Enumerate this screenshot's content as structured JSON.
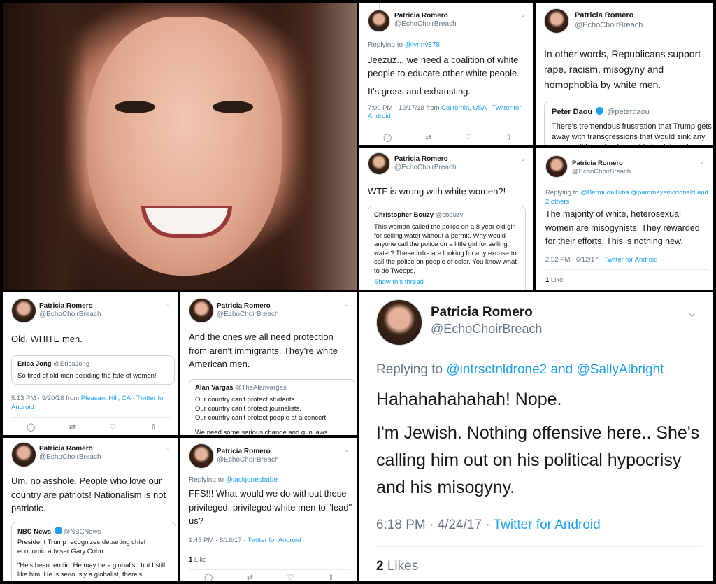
{
  "author": {
    "name": "Patricia Romero",
    "handle": "@EchoChoirBreach"
  },
  "icons": {
    "reply": "reply-icon",
    "retweet": "retweet-icon",
    "like": "heart-icon",
    "share": "share-icon",
    "chevron": "chevron-down-icon"
  },
  "colors": {
    "link": "#1da1f2",
    "muted": "#657786",
    "border": "#ccd6dd"
  },
  "t1": {
    "reply_prefix": "Replying to ",
    "reply_to": "@lynnv378",
    "text1": "Jeezuz... we need a coalition of white people to educate other white people.",
    "text2": "It's gross and exhausting.",
    "time": "7:00 PM · 12/17/18 from ",
    "place": "California, USA",
    "sep": " · ",
    "source": "Twitter for Android"
  },
  "t2": {
    "text": "In other words, Republicans support rape, racism, misogyny and homophobia by white men.",
    "quote": {
      "name": "Peter Daou",
      "handle": "@peterdaou",
      "text": "There's tremendous frustration that Trump gets away with transgressions that would sink any other politician (and possibly land them in"
    }
  },
  "t3": {
    "text": "WTF is wrong with white women?!",
    "quote": {
      "name": "Christopher Bouzy",
      "handle": "@cbouzy",
      "text": "This woman called the police on a 8 year old girl for selling water without a permit. Why would anyone call the police on a little girl for selling water? These folks are looking for any excuse to call the police on people of color. You know what to do Tweeps.",
      "more": "Show this thread"
    }
  },
  "t4": {
    "reply_prefix": "Replying to ",
    "reply_to": "@BermudaTuba @pammaysmcdonald and 2 others",
    "text": "The majority of white, heterosexual women are misogynists. They rewarded for their efforts. This is nothing new.",
    "time": "2:52 PM · 6/12/17 · ",
    "source": "Twitter for Android",
    "likes_num": "1",
    "likes_label": " Like"
  },
  "t5": {
    "text": "Old, WHITE men.",
    "quote": {
      "name": "Erica Jong",
      "handle": "@EricaJong",
      "text": "So tired of old men deciding the fate of women!"
    },
    "time": "5:13 PM · 9/20/18 from ",
    "place": "Pleasant Hill, CA",
    "sep": " · ",
    "source": "Twitter for Android"
  },
  "t6": {
    "text": "And the ones we all need protection from aren't immigrants. They're white American men.",
    "quote": {
      "name": "Alan Vargas",
      "handle": "@TheAlanvargas",
      "l1": "Our country can't protect students.",
      "l2": "Our country can't protect journalists.",
      "l3": "Our country can't protect people at a concert.",
      "l4": "We need some serious change and gun laws..."
    }
  },
  "t7": {
    "reply_prefix": "Replying to ",
    "reply_to": "@intrsctnldrone2 and @SallyAlbright",
    "text1": "Hahahahahahah! Nope.",
    "text2": "I'm Jewish. Nothing offensive here.. She's calling him out on his political hypocrisy and his misogyny.",
    "time": "6:18 PM · 4/24/17 · ",
    "source": "Twitter for Android",
    "likes_num": "2",
    "likes_label": " Likes"
  },
  "t8": {
    "text": "Um, no asshole. People who love our country are patriots! Nationalism is not patriotic.",
    "quote": {
      "name": "NBC News",
      "handle": "@NBCNews",
      "l1": "President Trump recognizes departing chief economic adviser Gary Cohn:",
      "l2": "\"He's been terrific. He may be a globalist, but I still like him. He is seriously a globalist, there's"
    }
  },
  "t9": {
    "reply_prefix": "Replying to ",
    "reply_to": "@jackjonesbabe",
    "text": "FFS!!! What would we do without these privileged, privileged white men to \"lead\" us?",
    "time": "1:45 PM · 8/16/17 · ",
    "source": "Twitter for Android",
    "likes_num": "1",
    "likes_label": " Like"
  }
}
